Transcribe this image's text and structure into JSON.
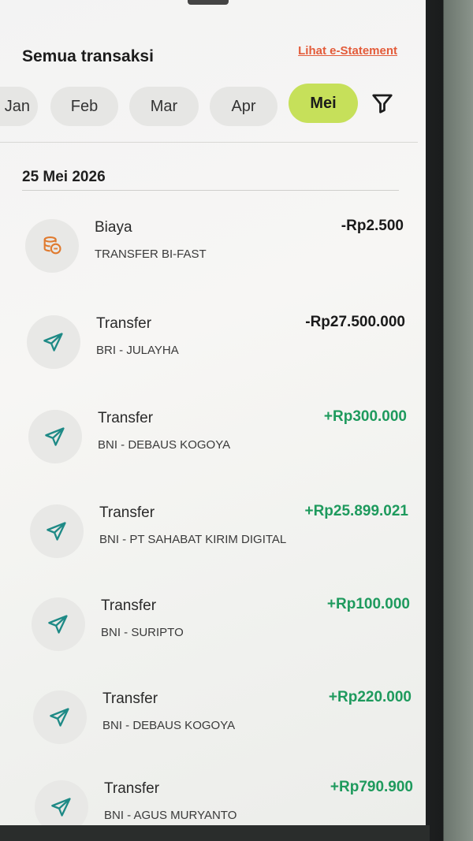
{
  "header": {
    "title": "Semua transaksi",
    "estatement_link": "Lihat e-Statement"
  },
  "months": [
    {
      "label": "Jan"
    },
    {
      "label": "Feb"
    },
    {
      "label": "Mar"
    },
    {
      "label": "Apr"
    },
    {
      "label": "Mei",
      "active": true
    }
  ],
  "date_heading": "25 Mei 2026",
  "transactions": [
    {
      "title": "Biaya",
      "subtitle": "TRANSFER BI-FAST",
      "amount": "-Rp2.500",
      "icon": "fee-coins-icon"
    },
    {
      "title": "Transfer",
      "subtitle": "BRI - JULAYHA",
      "amount": "-Rp27.500.000",
      "icon": "send-icon"
    },
    {
      "title": "Transfer",
      "subtitle": "BNI - DEBAUS KOGOYA",
      "amount": "+Rp300.000",
      "icon": "send-icon"
    },
    {
      "title": "Transfer",
      "subtitle": "BNI - PT SAHABAT KIRIM DIGITAL",
      "amount": "+Rp25.899.021",
      "icon": "send-icon"
    },
    {
      "title": "Transfer",
      "subtitle": "BNI - SURIPTO",
      "amount": "+Rp100.000",
      "icon": "send-icon"
    },
    {
      "title": "Transfer",
      "subtitle": "BNI - DEBAUS KOGOYA",
      "amount": "+Rp220.000",
      "icon": "send-icon"
    },
    {
      "title": "Transfer",
      "subtitle": "BNI - AGUS MURYANTO",
      "amount": "+Rp790.900",
      "icon": "send-icon"
    }
  ],
  "colors": {
    "accent_link": "#e35b3a",
    "active_month": "#c6e05a",
    "positive_amount": "#1e9a5d",
    "icon_teal": "#1e8a86",
    "icon_orange": "#e07a2e"
  }
}
